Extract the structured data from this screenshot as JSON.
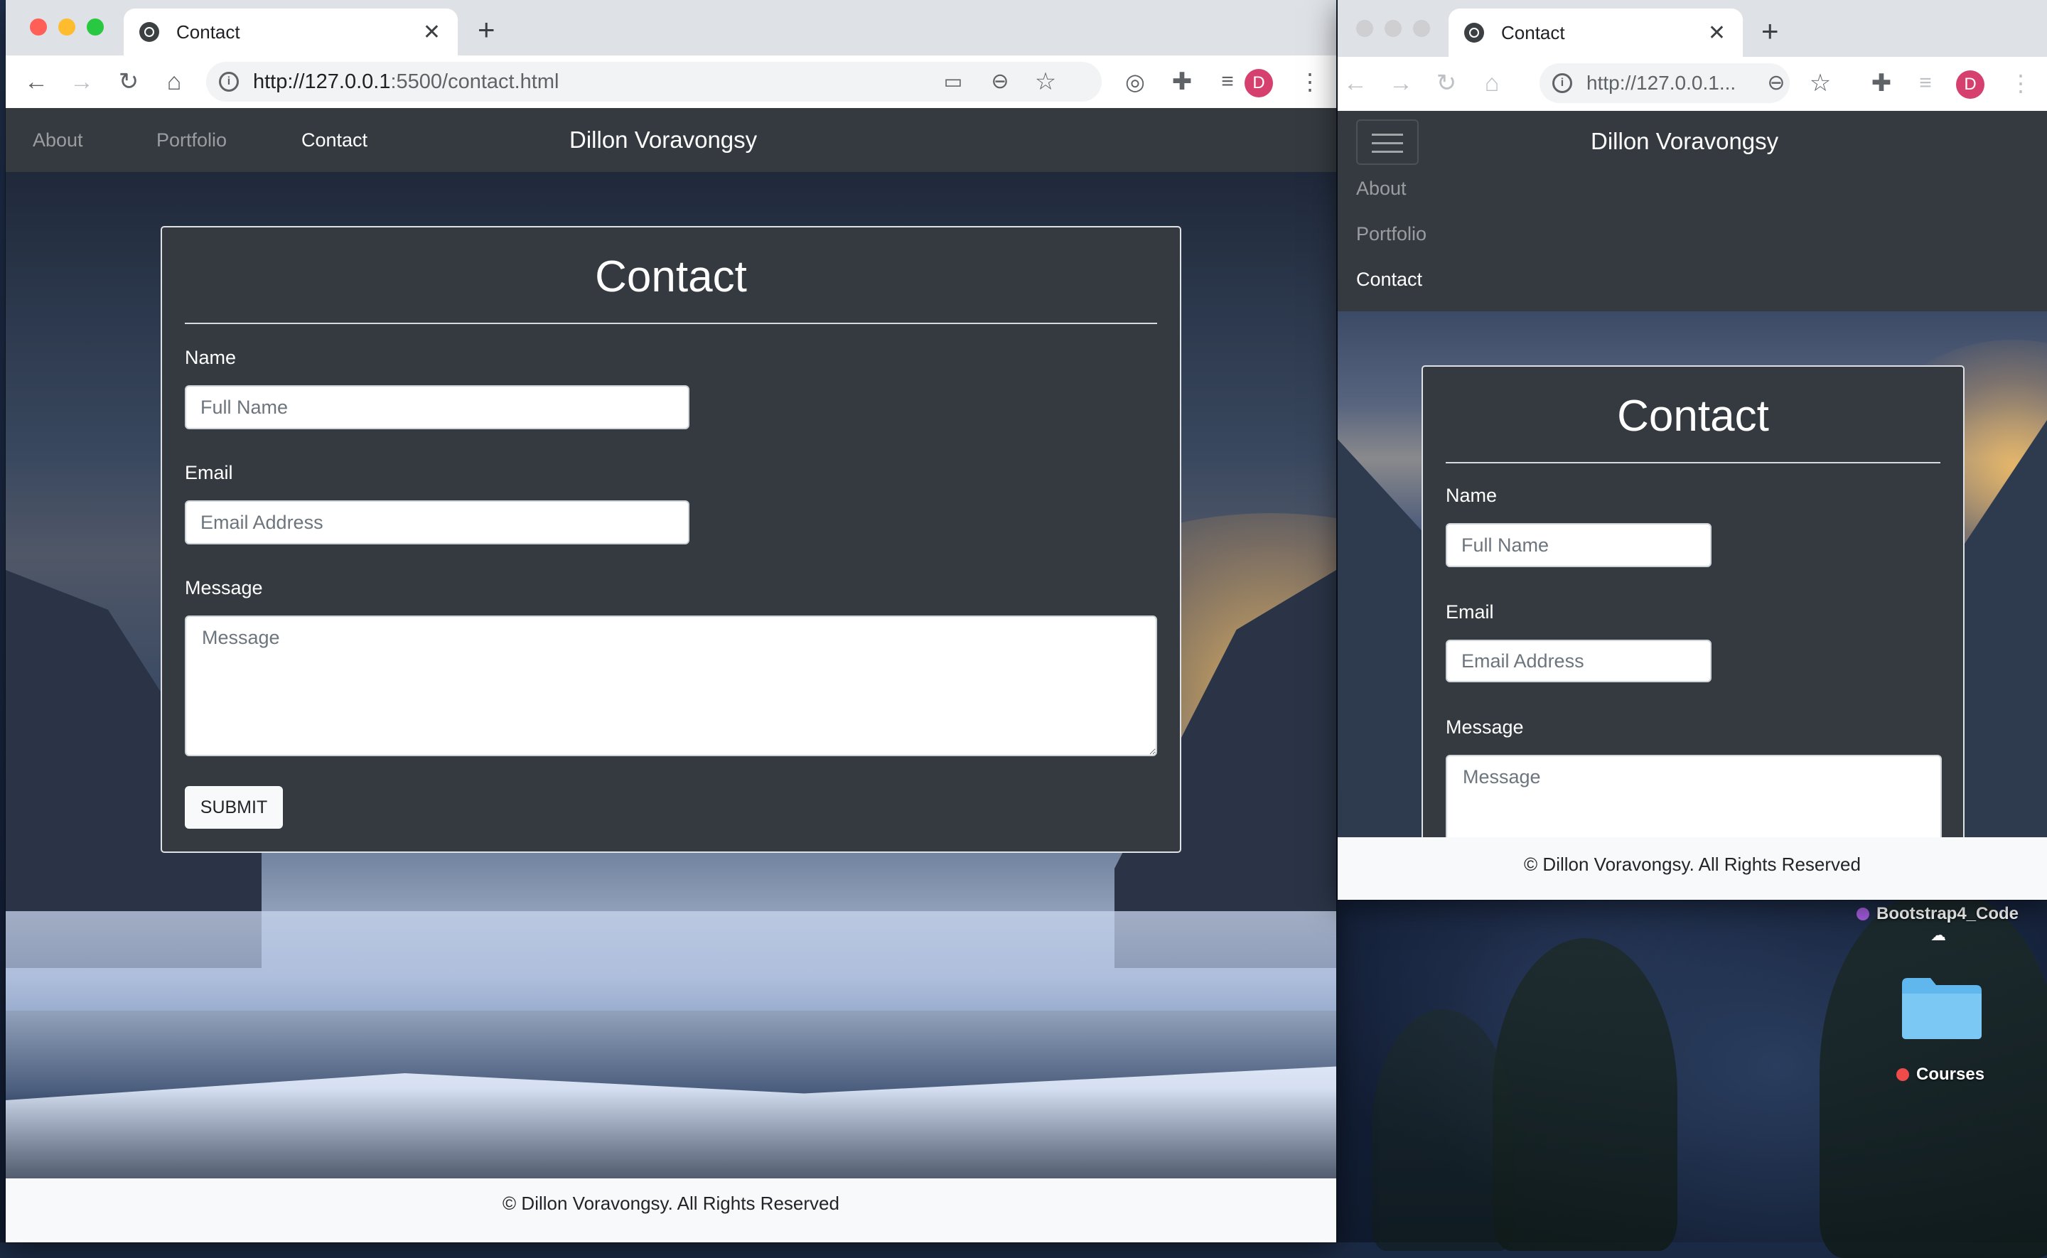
{
  "browser_main": {
    "tab_title": "Contact",
    "url_host": "http://127.0.0.1",
    "url_path": ":5500/contact.html",
    "profile_initial": "D"
  },
  "browser_small": {
    "tab_title": "Contact",
    "url_text": "http://127.0.0.1...",
    "profile_initial": "D"
  },
  "nav": {
    "brand": "Dillon Voravongsy",
    "items": [
      {
        "label": "About"
      },
      {
        "label": "Portfolio"
      },
      {
        "label": "Contact",
        "active": true
      }
    ]
  },
  "form": {
    "heading": "Contact",
    "name_label": "Name",
    "name_placeholder": "Full Name",
    "email_label": "Email",
    "email_placeholder": "Email Address",
    "message_label": "Message",
    "message_placeholder": "Message",
    "submit_label": "SUBMIT"
  },
  "footer": {
    "text": "© Dillon Voravongsy. All Rights Reserved"
  },
  "desktop": {
    "items": [
      {
        "label": "Bootstrap4_Code",
        "tag_color": "#a55ee0"
      },
      {
        "label": "Courses",
        "tag_color": "#ef4b4b"
      }
    ]
  },
  "colors": {
    "navbar": "#343a40",
    "footer": "#f8f9fa",
    "avatar": "#d5406e",
    "traffic_close": "#ff5f57",
    "traffic_min": "#febc2e",
    "traffic_max": "#28c840"
  },
  "icons": [
    "globe-icon",
    "close-icon",
    "plus-icon",
    "back-icon",
    "forward-icon",
    "reload-icon",
    "home-icon",
    "info-icon",
    "cast-icon",
    "zoom-icon",
    "star-icon",
    "extension-icon",
    "puzzle-icon",
    "media-icon",
    "menu-dots-icon",
    "hamburger-icon",
    "folder-icon",
    "cloud-icon"
  ]
}
